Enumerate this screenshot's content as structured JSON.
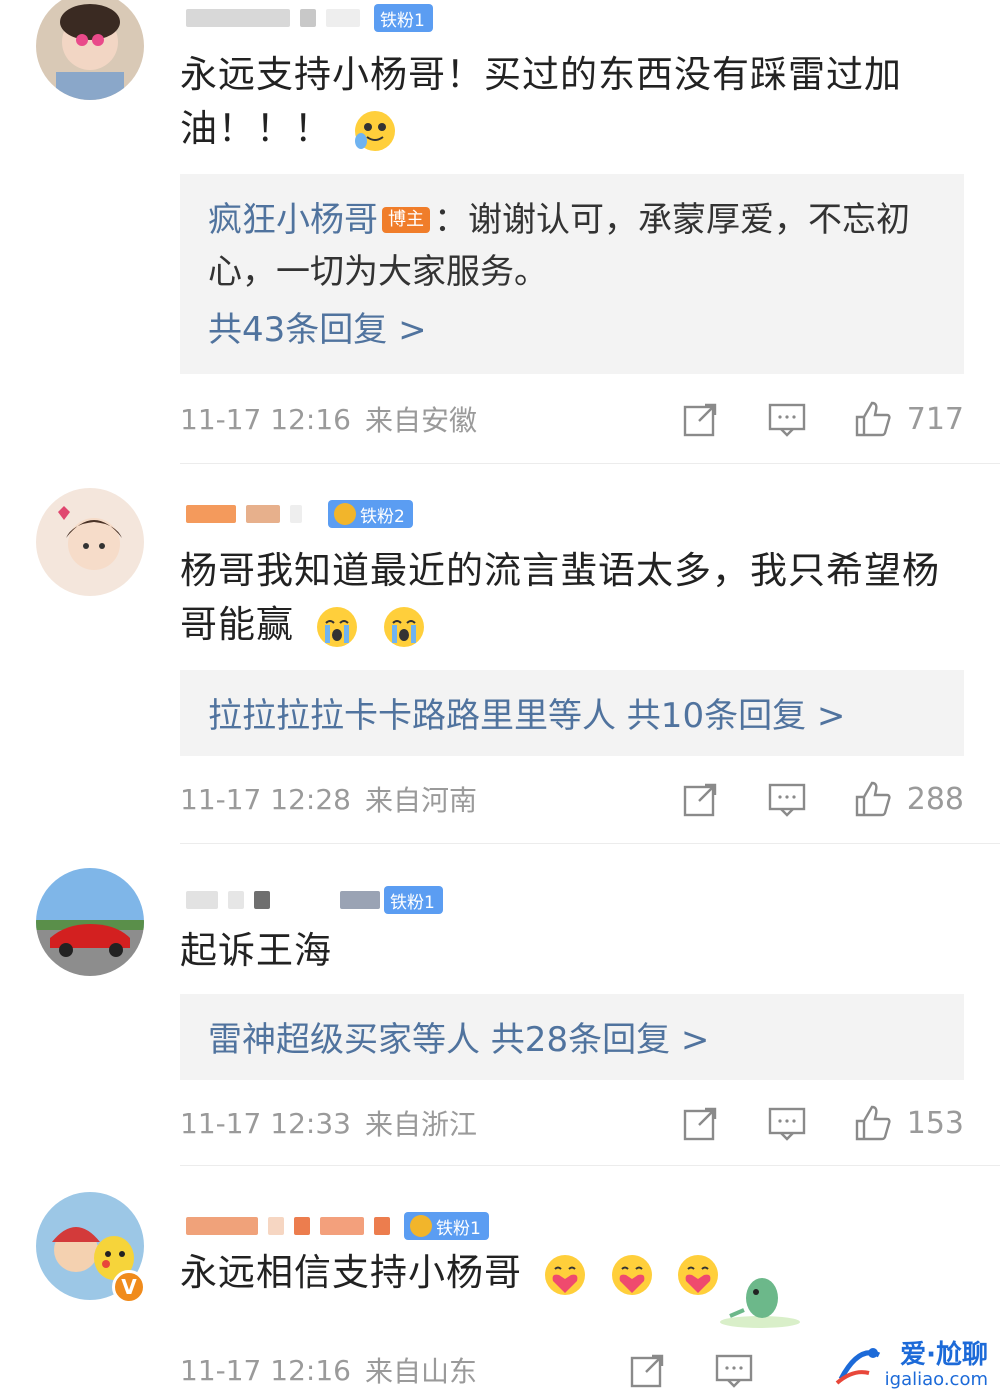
{
  "comments": [
    {
      "fan_badge": "铁粉1",
      "text": "永远支持小杨哥！买过的东西没有踩雷过加油！！！",
      "reply": {
        "author": "疯狂小杨哥",
        "author_tag": "博主",
        "content": "：谢谢认可，承蒙厚爱，不忘初心，一切为大家服务。",
        "link": "共43条回复 >"
      },
      "time": "11-17 12:16",
      "location": "来自安徽",
      "likes": "717"
    },
    {
      "fan_badge": "铁粉2",
      "text": "杨哥我知道最近的流言蜚语太多，我只希望杨哥能赢",
      "reply": {
        "link": "拉拉拉拉卡卡路路里里等人 共10条回复 >"
      },
      "time": "11-17 12:28",
      "location": "来自河南",
      "likes": "288"
    },
    {
      "fan_badge": "铁粉1",
      "text": "起诉王海",
      "reply": {
        "link": "雷神超级买家等人 共28条回复 >"
      },
      "time": "11-17 12:33",
      "location": "来自浙江",
      "likes": "153"
    },
    {
      "fan_badge": "铁粉1",
      "text": "永远相信支持小杨哥",
      "verified_badge": "V",
      "time": "11-17 12:16",
      "location": "来自山东"
    }
  ],
  "watermark": {
    "cn": "爱·尬聊",
    "en": "igaliao.com"
  },
  "icons": {
    "share": "share-icon",
    "comment": "comment-icon",
    "like": "thumbs-up-icon"
  },
  "colors": {
    "link_blue": "#50739e",
    "fan_badge": "#5b9df2",
    "host_tag": "#f07d2a",
    "meta_gray": "#9a9a9a",
    "reply_bg": "#f3f3f3"
  }
}
